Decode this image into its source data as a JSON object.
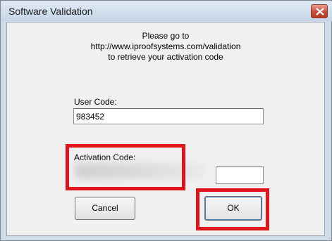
{
  "window": {
    "title": "Software Validation"
  },
  "message": {
    "line1": "Please go to",
    "line2": "http://www.iproofsystems.com/validation",
    "line3": "to retrieve your activation code"
  },
  "user_code": {
    "label": "User Code:",
    "value": "983452"
  },
  "activation_code": {
    "label": "Activation Code:",
    "value": ""
  },
  "buttons": {
    "cancel": "Cancel",
    "ok": "OK"
  },
  "annotations": {
    "highlight_color": "#e0141c"
  }
}
